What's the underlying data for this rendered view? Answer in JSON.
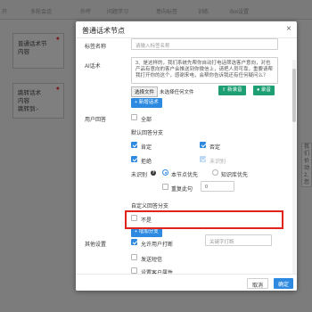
{
  "top_nav": {
    "items": [
      "开",
      "多轮会话",
      "外呼",
      "问题学习",
      "意向标签",
      "训练",
      "Bot设置"
    ]
  },
  "canvas": {
    "nodes": [
      {
        "title": "普通话术节",
        "body": "内容"
      },
      {
        "title": "跳转话术",
        "body": "内容",
        "jump": "跳转到:-"
      }
    ],
    "right_card": [
      "我们",
      "价",
      "动",
      "2,您"
    ]
  },
  "modal": {
    "title": "普通话术节点",
    "close_icon": "close-icon",
    "tag_name": {
      "label": "标签名称",
      "placeholder": "请输入标签名称"
    },
    "ai_script": {
      "label": "AI话术",
      "value": "3、是这样的，我们系统先帮你自动打电话筛选客户意向，对也产品有意向的客户会推送到你微信上，请把人员可靠，重要请帮我打开你的这个，感谢来电，会帮你告诉我还有任何疑问么？",
      "choose_file": "选择文件",
      "no_file": "未选择任何文件",
      "record_label": "新录音",
      "tts_label": "录音",
      "add_script": "+ 新增话术"
    },
    "user_answer": {
      "label": "用户回答",
      "all_label": "全部",
      "default_branch": "默认回答分支",
      "options": [
        {
          "label": "肯定",
          "checked": true,
          "disabled": false
        },
        {
          "label": "否定",
          "checked": true,
          "disabled": false
        },
        {
          "label": "拒绝",
          "checked": true,
          "disabled": false
        },
        {
          "label": "未识别",
          "checked": true,
          "disabled": true
        }
      ],
      "unrecognized_label": "未识别",
      "radios": [
        {
          "label": "本节点优先",
          "selected": true
        },
        {
          "label": "知识库优先",
          "selected": false
        }
      ],
      "repeat_label": "重复此句",
      "repeat_value": "0",
      "custom_branch": "自定义回答分支",
      "custom_options": [
        {
          "label": "不是",
          "checked": false
        }
      ],
      "add_branch": "+ 增加分支"
    },
    "other_settings": {
      "label": "其他设置",
      "allow_interrupt": {
        "label": "允许用户打断",
        "checked": true
      },
      "keyword_placeholder": "关键字打断",
      "send_sms": {
        "label": "发送短信",
        "checked": false
      },
      "set_attrs": {
        "label": "设置客户属性",
        "checked": false
      }
    },
    "footer": {
      "cancel": "取消",
      "ok": "确定"
    }
  },
  "colors": {
    "primary": "#2d8ae0",
    "green": "#1e9f73",
    "highlight": "#e2231a",
    "overlay": "#7d7d7d"
  }
}
